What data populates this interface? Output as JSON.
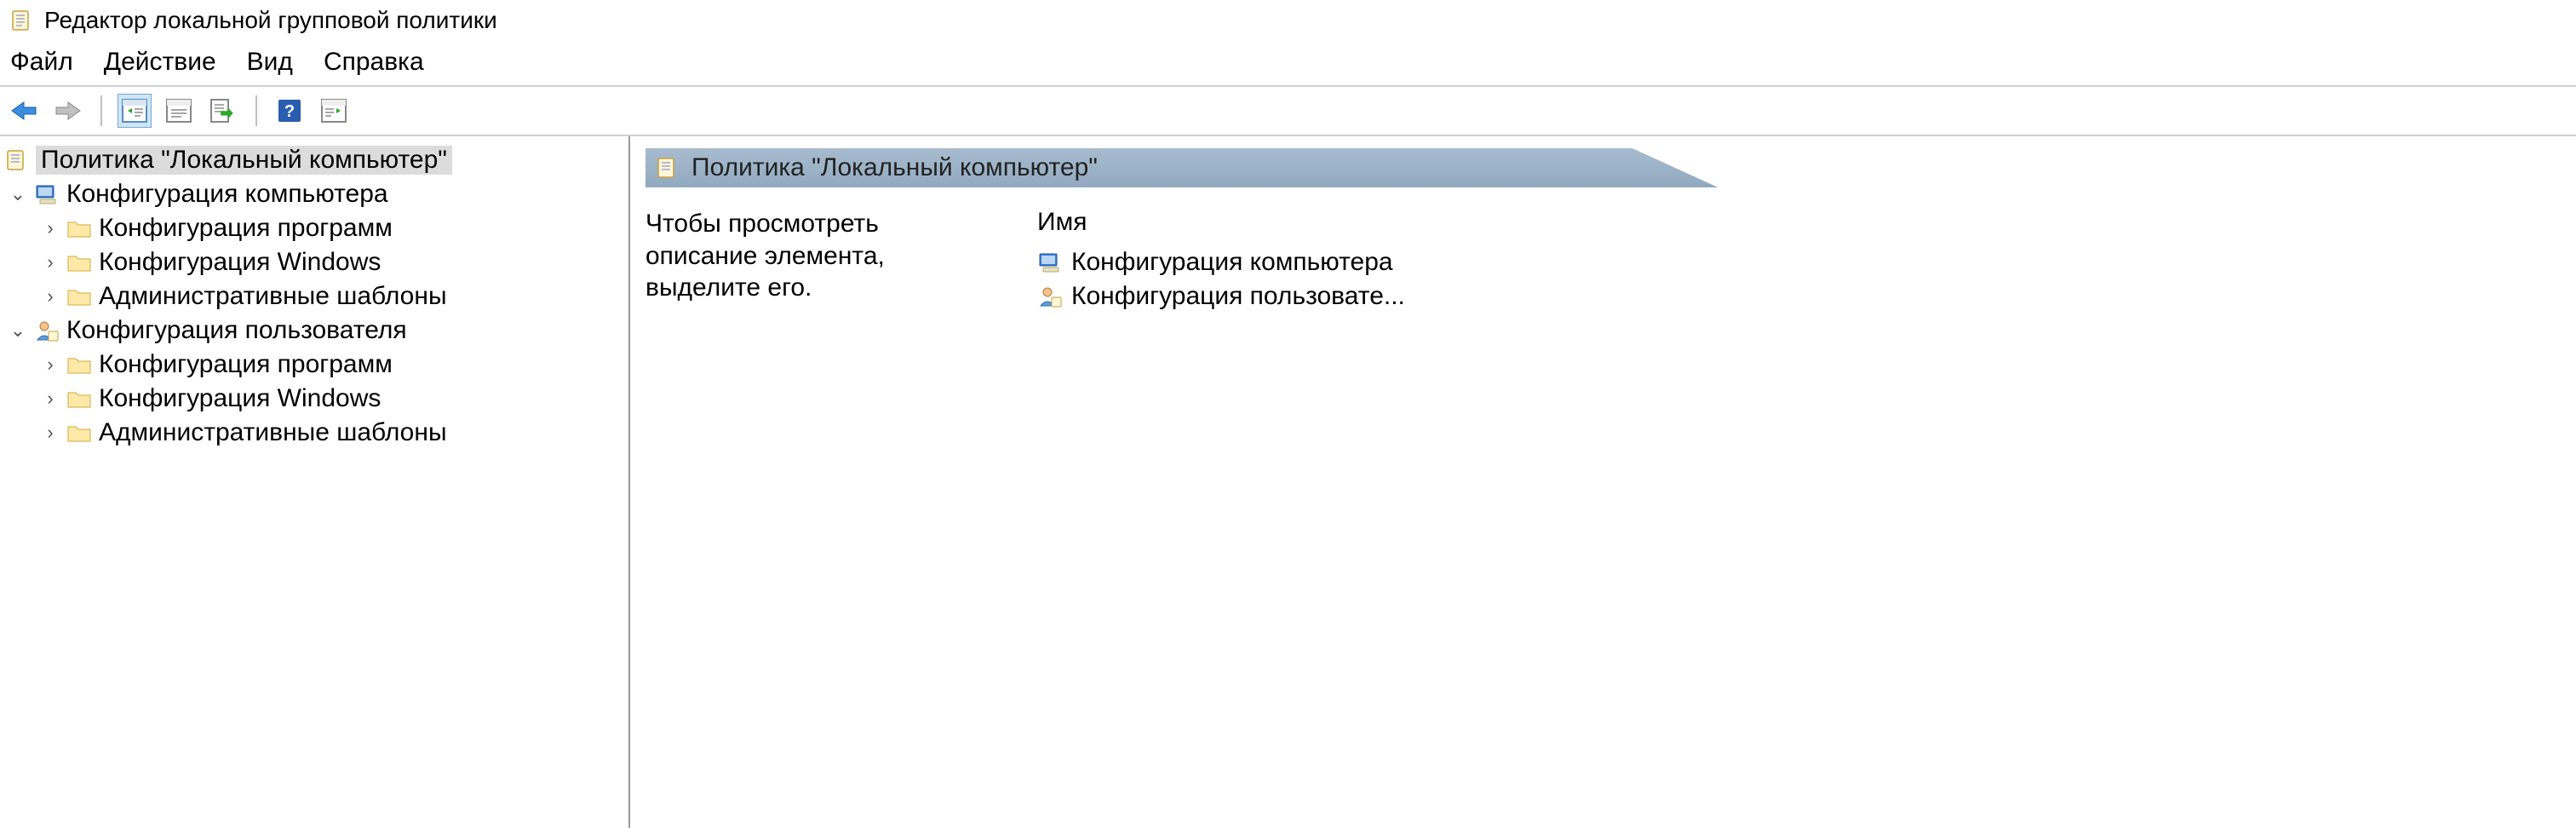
{
  "window": {
    "title": "Редактор локальной групповой политики"
  },
  "menu": {
    "file": "Файл",
    "action": "Действие",
    "view": "Вид",
    "help": "Справка"
  },
  "tree": {
    "root": "Политика \"Локальный компьютер\"",
    "computer": {
      "label": "Конфигурация компьютера",
      "children": {
        "software": "Конфигурация программ",
        "windows": "Конфигурация Windows",
        "admin": "Административные шаблоны"
      }
    },
    "user": {
      "label": "Конфигурация пользователя",
      "children": {
        "software": "Конфигурация программ",
        "windows": "Конфигурация Windows",
        "admin": "Административные шаблоны"
      }
    }
  },
  "right": {
    "header": "Политика \"Локальный компьютер\"",
    "description": "Чтобы просмотреть описание элемента, выделите его.",
    "column_name": "Имя",
    "items": {
      "computer": "Конфигурация компьютера",
      "user": "Конфигурация пользовате..."
    }
  }
}
